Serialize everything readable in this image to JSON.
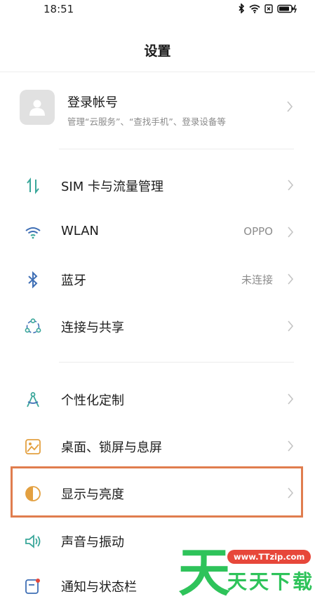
{
  "status": {
    "time": "18:51"
  },
  "title": "设置",
  "account": {
    "title": "登录帐号",
    "subtitle": "管理“云服务”、“查找手机”、登录设备等"
  },
  "groups": [
    [
      {
        "label": "SIM 卡与流量管理",
        "value": "",
        "icon": "sim-data-icon"
      },
      {
        "label": "WLAN",
        "value": "OPPO",
        "icon": "wifi-icon"
      },
      {
        "label": "蓝牙",
        "value": "未连接",
        "icon": "bluetooth-icon"
      },
      {
        "label": "连接与共享",
        "value": "",
        "icon": "connection-share-icon"
      }
    ],
    [
      {
        "label": "个性化定制",
        "value": "",
        "icon": "compass-icon"
      },
      {
        "label": "桌面、锁屏与息屏",
        "value": "",
        "icon": "wallpaper-icon"
      },
      {
        "label": "显示与亮度",
        "value": "",
        "icon": "brightness-icon"
      },
      {
        "label": "声音与振动",
        "value": "",
        "icon": "speaker-icon"
      },
      {
        "label": "通知与状态栏",
        "value": "",
        "icon": "notification-icon"
      }
    ]
  ],
  "watermark": {
    "big": "天",
    "url": "www.TTzip.com",
    "text": "天天下载"
  },
  "colors": {
    "teal": "#3aa79a",
    "blue": "#3f6fb5",
    "highlight": "#e07d4e",
    "watermark_green": "#2ec35a"
  }
}
